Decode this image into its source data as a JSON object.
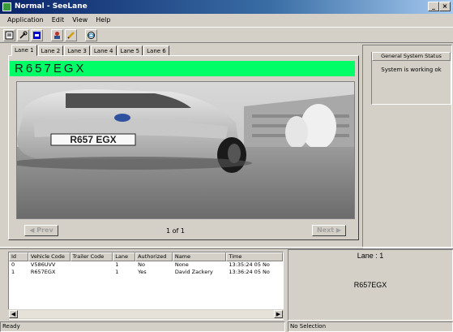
{
  "window": {
    "title": "Normal - SeeLane",
    "controls": [
      "_",
      "×"
    ]
  },
  "menu": [
    "Application",
    "Edit",
    "View",
    "Help"
  ],
  "toolbar": [
    "document-icon",
    "wrench-icon",
    "stop-icon",
    "user-icon",
    "pen-icon",
    "globe-icon"
  ],
  "tabs": [
    "Lane 1",
    "Lane 2",
    "Lane 3",
    "Lane 4",
    "Lane 5",
    "Lane 6"
  ],
  "active_tab": 0,
  "plate": {
    "text": "R657EGX",
    "color": "#00ff66"
  },
  "photo": {
    "plate_text": "R657 EGX"
  },
  "nav": {
    "prev": "◀ Prev",
    "page": "1  of  1",
    "next": "Next ▶"
  },
  "status_panel": {
    "header": "General System Status",
    "message": "System is working ok"
  },
  "list": {
    "columns": [
      "Id",
      "Vehicle Code",
      "Trailer Code",
      "Lane",
      "Authorized",
      "Name",
      "Time"
    ],
    "rows": [
      [
        "0",
        "V586UVV",
        "",
        "1",
        "No",
        "None",
        "13:35:24 05 No"
      ],
      [
        "1",
        "R657EGX",
        "",
        "1",
        "Yes",
        "David Zackery",
        "13:36:24 05 No"
      ]
    ]
  },
  "detail": {
    "lane": "Lane : 1",
    "plate": "R657EGX"
  },
  "statusbar": {
    "left": "Ready",
    "right": "No Selection"
  }
}
